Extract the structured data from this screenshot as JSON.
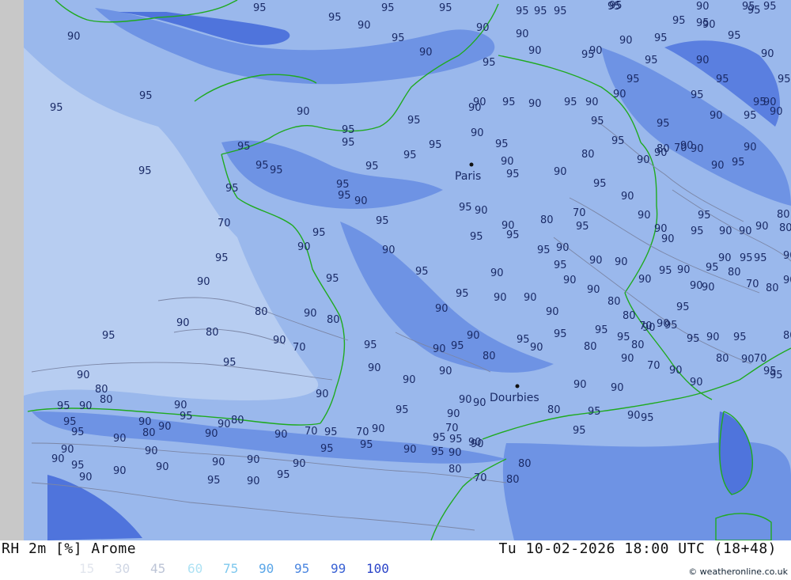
{
  "map": {
    "colors": {
      "sea_background": "#9ab8ec",
      "deeper_blue": "#6e93e4",
      "deepest_blue": "#4f74dc",
      "pale_blue": "#b7cdf1",
      "coastline": "#1faa1f",
      "no_data": "#c8c8c8",
      "contour": "#7b86a6"
    },
    "cities": [
      {
        "name": "Paris"
      },
      {
        "name": "Dourbies"
      }
    ],
    "contour_values": [
      "95",
      "95",
      "95",
      "95",
      "95",
      "95",
      "95",
      "95",
      "90",
      "90",
      "90",
      "95",
      "90",
      "90",
      "95",
      "95",
      "90",
      "90",
      "95",
      "90",
      "95",
      "90",
      "95",
      "95",
      "95",
      "95",
      "95",
      "90",
      "90",
      "90",
      "95",
      "95",
      "95",
      "95",
      "90",
      "95",
      "90",
      "95",
      "95",
      "90",
      "90",
      "90",
      "90",
      "95",
      "95",
      "95",
      "95",
      "95",
      "95",
      "95",
      "95",
      "90",
      "90",
      "90",
      "90",
      "90",
      "90",
      "95",
      "90",
      "90",
      "95",
      "95",
      "95",
      "95",
      "95",
      "95",
      "95",
      "95",
      "90",
      "95",
      "90",
      "95",
      "90",
      "80",
      "80",
      "70",
      "90",
      "95",
      "95",
      "95",
      "95",
      "95",
      "90",
      "95",
      "90",
      "80",
      "70",
      "95",
      "95",
      "90",
      "90",
      "90",
      "90",
      "95",
      "95",
      "90",
      "90",
      "90",
      "80",
      "80",
      "70",
      "95",
      "90",
      "95",
      "95",
      "90",
      "95",
      "95",
      "90",
      "95",
      "90",
      "90",
      "90",
      "90",
      "95",
      "90",
      "90",
      "95",
      "90",
      "95",
      "95",
      "90",
      "95",
      "95",
      "90",
      "95",
      "95",
      "90",
      "90",
      "90",
      "90",
      "80",
      "80",
      "70",
      "90",
      "95",
      "90",
      "80",
      "70",
      "80",
      "90",
      "90",
      "80",
      "90",
      "80",
      "95",
      "90",
      "90",
      "95",
      "95",
      "95",
      "95",
      "90",
      "95",
      "95",
      "90",
      "95",
      "70",
      "80",
      "90",
      "80",
      "90",
      "70",
      "90",
      "95",
      "90",
      "80",
      "90",
      "80",
      "90",
      "80",
      "70",
      "90",
      "90",
      "80",
      "90",
      "95",
      "95",
      "95",
      "95",
      "90",
      "90",
      "90",
      "90",
      "90",
      "90",
      "80",
      "90",
      "95",
      "90",
      "90",
      "95",
      "90",
      "80",
      "90",
      "95",
      "95",
      "70",
      "90",
      "80",
      "95",
      "90",
      "90",
      "95",
      "90",
      "90",
      "95",
      "90",
      "80",
      "90",
      "80",
      "90",
      "95",
      "90",
      "70",
      "95",
      "70",
      "90",
      "95",
      "95",
      "90",
      "95",
      "90",
      "95",
      "90",
      "95",
      "90",
      "90",
      "95",
      "90",
      "90",
      "90",
      "80",
      "70",
      "80",
      "80",
      "90",
      "90",
      "90",
      "90",
      "95",
      "90",
      "95"
    ]
  },
  "footer": {
    "title": "RH 2m [%] Arome",
    "time": "Tu 10-02-2026 18:00 UTC (18+48)",
    "credit": "© weatheronline.co.uk",
    "legend": [
      {
        "label": "15",
        "color": "#e2e6ee"
      },
      {
        "label": "30",
        "color": "#cfd6e4"
      },
      {
        "label": "45",
        "color": "#bcc4d6"
      },
      {
        "label": "60",
        "color": "#aee2f4"
      },
      {
        "label": "75",
        "color": "#7ec8ee"
      },
      {
        "label": "90",
        "color": "#5aa6e8"
      },
      {
        "label": "95",
        "color": "#4b86e0"
      },
      {
        "label": "99",
        "color": "#3a62d4"
      },
      {
        "label": "100",
        "color": "#2a44c8"
      }
    ]
  }
}
